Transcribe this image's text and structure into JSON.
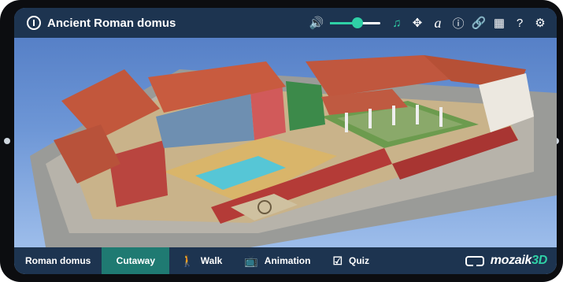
{
  "app": {
    "title": "Ancient Roman domus"
  },
  "toolbar": {
    "volume_level": 0.55
  },
  "tabs": [
    {
      "label": "Roman domus",
      "active": false
    },
    {
      "label": "Cutaway",
      "active": true
    },
    {
      "label": "Walk",
      "active": false,
      "icon": "walk-icon"
    },
    {
      "label": "Animation",
      "active": false,
      "icon": "tv-icon"
    },
    {
      "label": "Quiz",
      "active": false,
      "icon": "quiz-icon"
    }
  ],
  "brand": {
    "name": "mozaik",
    "suffix": "3D"
  },
  "colors": {
    "bar": "#1d3450",
    "accent": "#2fd0a6",
    "active_tab": "#1f7a72"
  }
}
